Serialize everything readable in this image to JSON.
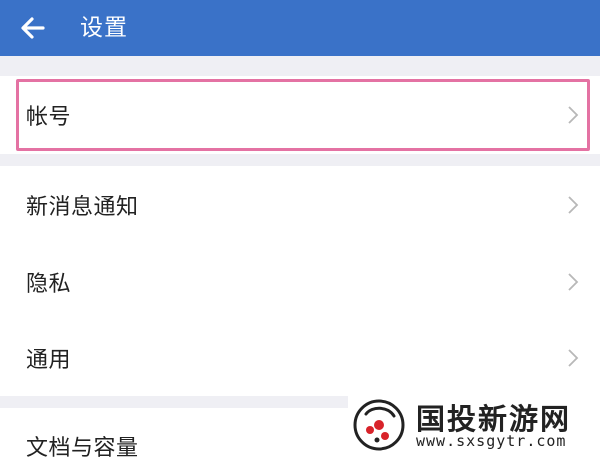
{
  "header": {
    "title": "设置",
    "back_icon": "arrow-left-icon",
    "bg_color": "#3a72c8"
  },
  "settings": {
    "items": [
      {
        "label": "帐号",
        "icon": "chevron-right-icon",
        "highlighted": true
      },
      {
        "label": "新消息通知",
        "icon": "chevron-right-icon"
      },
      {
        "label": "隐私",
        "icon": "chevron-right-icon"
      },
      {
        "label": "通用",
        "icon": "chevron-right-icon"
      },
      {
        "label": "文档与容量"
      }
    ],
    "highlight_color": "#e472a3"
  },
  "watermark": {
    "title": "国投新游网",
    "url": "www.sxsgytr.com"
  }
}
